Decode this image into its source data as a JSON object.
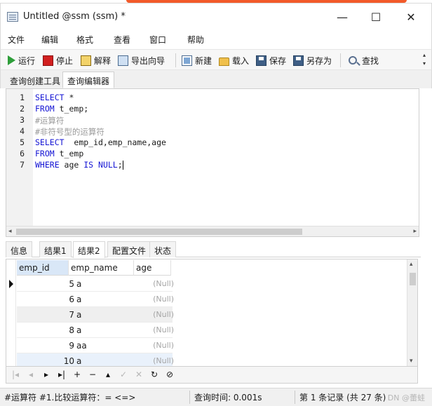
{
  "window": {
    "title": "Untitled @ssm (ssm) *",
    "controls": {
      "minimize": "—",
      "maximize": "☐",
      "close": "✕"
    }
  },
  "menu": [
    "文件",
    "编辑",
    "格式",
    "查看",
    "窗口",
    "帮助"
  ],
  "toolbar": {
    "run": "运行",
    "stop": "停止",
    "explain": "解释",
    "export_wizard": "导出向导",
    "new": "新建",
    "load": "载入",
    "save": "保存",
    "save_as": "另存为",
    "find": "查找",
    "more": "▴\n▾"
  },
  "editor_tabs": [
    {
      "label": "查询创建工具",
      "active": false
    },
    {
      "label": "查询编辑器",
      "active": true
    }
  ],
  "editor": {
    "line_numbers": [
      "1",
      "2",
      "3",
      "4",
      "5",
      "6",
      "7"
    ],
    "lines": [
      [
        {
          "t": "SELECT",
          "k": "kw"
        },
        {
          "t": " *",
          "k": ""
        }
      ],
      [
        {
          "t": "FROM",
          "k": "kw"
        },
        {
          "t": " t_emp;",
          "k": ""
        }
      ],
      [
        {
          "t": "#运算符",
          "k": "cm"
        }
      ],
      [
        {
          "t": "#非符号型的运算符",
          "k": "cm"
        }
      ],
      [
        {
          "t": "SELECT",
          "k": "kw"
        },
        {
          "t": "  emp_id,emp_name,age",
          "k": ""
        }
      ],
      [
        {
          "t": "FROM",
          "k": "kw"
        },
        {
          "t": " t_emp",
          "k": ""
        }
      ],
      [
        {
          "t": "WHERE",
          "k": "kw"
        },
        {
          "t": " age ",
          "k": ""
        },
        {
          "t": "IS NULL",
          "k": "kw"
        },
        {
          "t": ";",
          "k": ""
        }
      ]
    ]
  },
  "result_tabs": [
    {
      "label": "信息",
      "active": false
    },
    {
      "label": "结果1",
      "active": false
    },
    {
      "label": "结果2",
      "active": true
    },
    {
      "label": "配置文件",
      "active": false
    },
    {
      "label": "状态",
      "active": false
    }
  ],
  "grid": {
    "columns": [
      "emp_id",
      "emp_name",
      "age"
    ],
    "rows": [
      {
        "emp_id": "5",
        "emp_name": "a",
        "age": "(Null)"
      },
      {
        "emp_id": "6",
        "emp_name": "a",
        "age": "(Null)"
      },
      {
        "emp_id": "7",
        "emp_name": "a",
        "age": "(Null)"
      },
      {
        "emp_id": "8",
        "emp_name": "a",
        "age": "(Null)"
      },
      {
        "emp_id": "9",
        "emp_name": "aa",
        "age": "(Null)"
      },
      {
        "emp_id": "10",
        "emp_name": "a",
        "age": "(Null)"
      }
    ]
  },
  "nav_buttons": [
    {
      "glyph": "|◂",
      "name": "first-record-button",
      "enabled": false
    },
    {
      "glyph": "◂",
      "name": "prev-record-button",
      "enabled": false
    },
    {
      "glyph": "▸",
      "name": "next-record-button",
      "enabled": true
    },
    {
      "glyph": "▸|",
      "name": "last-record-button",
      "enabled": true
    },
    {
      "glyph": "+",
      "name": "add-record-button",
      "enabled": true
    },
    {
      "glyph": "−",
      "name": "delete-record-button",
      "enabled": true
    },
    {
      "glyph": "▴",
      "name": "apply-changes-button",
      "enabled": true
    },
    {
      "glyph": "✓",
      "name": "confirm-button",
      "enabled": false
    },
    {
      "glyph": "✕",
      "name": "discard-button",
      "enabled": false
    },
    {
      "glyph": "↻",
      "name": "refresh-button",
      "enabled": true
    },
    {
      "glyph": "⊘",
      "name": "stop-button",
      "enabled": true
    }
  ],
  "status": {
    "hint": "#运算符 #1.比较运算符：= <=>",
    "query_time": "查询时间: 0.001s",
    "record_info": "第 1 条记录 (共 27 条)",
    "watermark": "DN @蕾蛙"
  },
  "colors": {
    "keyword": "#1414d4",
    "comment": "#9a9a9a",
    "run_icon": "#2e9e3a",
    "stop_icon": "#d11f1f",
    "null_text": "#a5a5a5"
  }
}
